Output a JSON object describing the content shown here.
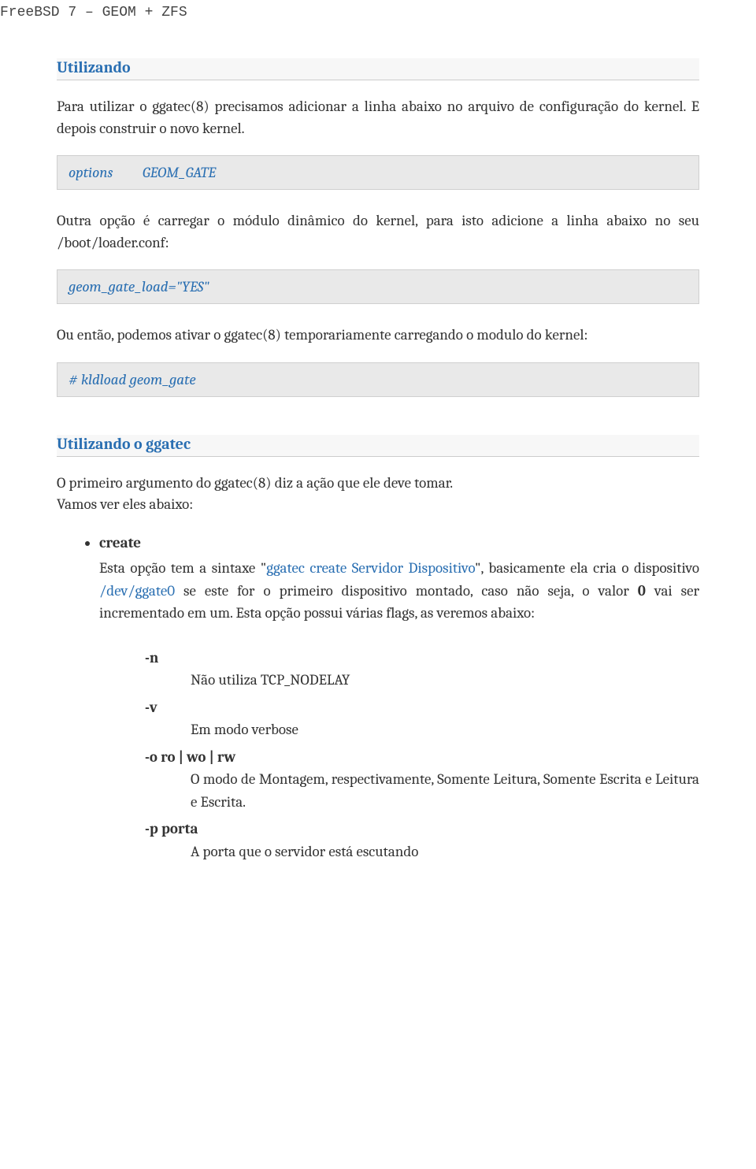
{
  "header": "FreeBSD 7 – GEOM + ZFS",
  "section1": {
    "title": "Utilizando",
    "p1": "Para utilizar o ggatec(8) precisamos adicionar a linha abaixo no arquivo de configuração do kernel. E depois construir o novo kernel.",
    "code1": "options         GEOM_GATE",
    "p2": "Outra opção é carregar o módulo dinâmico do kernel, para isto adicione a linha abaixo no seu /boot/loader.conf:",
    "code2": "geom_gate_load=\"YES\"",
    "p3": "Ou então, podemos ativar o ggatec(8) temporariamente carregando o modulo do kernel:",
    "code3": "# kldload geom_gate"
  },
  "section2": {
    "title": "Utilizando o ggatec",
    "intro1": "O primeiro argumento do ggatec(8) diz a ação que ele deve tomar.",
    "intro2": "Vamos ver eles abaixo:",
    "item": {
      "name": "create",
      "seg1": "Esta opção tem a sintaxe \"",
      "seg2": "ggatec create Servidor Dispositivo",
      "seg3": "\", basicamente ela cria o dispositivo ",
      "seg4": "/dev/ggate0",
      "seg5": " se este for o primeiro dispositivo montado, caso não seja, o valor ",
      "seg6": "0",
      "seg7": " vai ser incrementado em um. Esta opção possui várias flags, as veremos abaixo:"
    },
    "flags": [
      {
        "name": "-n",
        "desc": "Não utiliza TCP_NODELAY"
      },
      {
        "name": "-v",
        "desc": "Em modo verbose"
      },
      {
        "name": "-o ro | wo | rw",
        "desc": "O modo de Montagem, respectivamente, Somente Leitura, Somente Escrita e Leitura e Escrita."
      },
      {
        "name": "-p porta",
        "desc": "A porta que o servidor está escutando"
      }
    ]
  }
}
